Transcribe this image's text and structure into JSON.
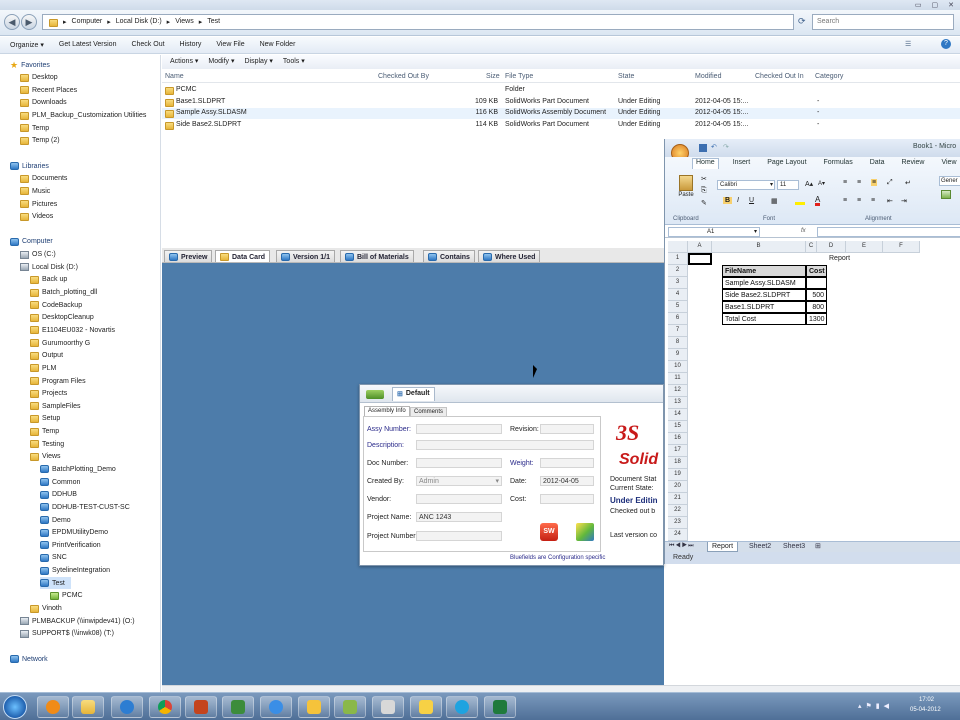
{
  "address": {
    "crumbs": [
      "Computer",
      "Local Disk (D:)",
      "Views",
      "Test"
    ],
    "search_placeholder": "Search"
  },
  "toolbar": [
    "Organize ▾",
    "Get Latest Version",
    "Check Out",
    "History",
    "View File",
    "New Folder"
  ],
  "nav": [
    {
      "label": "Favorites",
      "icon": "star-icon",
      "indent": 0
    },
    {
      "label": "Desktop",
      "icon": "folder-icon",
      "indent": 1
    },
    {
      "label": "Recent Places",
      "icon": "folder-icon",
      "indent": 1
    },
    {
      "label": "Downloads",
      "icon": "folder-icon",
      "indent": 1
    },
    {
      "label": "PLM_Backup_Customization Utilities",
      "icon": "folder-icon",
      "indent": 1
    },
    {
      "label": "Temp",
      "icon": "folder-icon",
      "indent": 1
    },
    {
      "label": "Temp (2)",
      "icon": "folder-icon",
      "indent": 1
    },
    {
      "label": "",
      "icon": "",
      "indent": 0
    },
    {
      "label": "Libraries",
      "icon": "library-icon",
      "indent": 0
    },
    {
      "label": "Documents",
      "icon": "folder-icon",
      "indent": 1
    },
    {
      "label": "Music",
      "icon": "folder-icon",
      "indent": 1
    },
    {
      "label": "Pictures",
      "icon": "folder-icon",
      "indent": 1
    },
    {
      "label": "Videos",
      "icon": "folder-icon",
      "indent": 1
    },
    {
      "label": "",
      "icon": "",
      "indent": 0
    },
    {
      "label": "Computer",
      "icon": "computer-icon",
      "indent": 0
    },
    {
      "label": "OS (C:)",
      "icon": "drive-icon",
      "indent": 1
    },
    {
      "label": "Local Disk (D:)",
      "icon": "drive-icon",
      "indent": 1
    },
    {
      "label": "Back up",
      "icon": "folder-icon",
      "indent": 2
    },
    {
      "label": "Batch_plotting_dll",
      "icon": "folder-icon",
      "indent": 2
    },
    {
      "label": "CodeBackup",
      "icon": "folder-icon",
      "indent": 2
    },
    {
      "label": "DesktopCleanup",
      "icon": "folder-icon",
      "indent": 2
    },
    {
      "label": "E1104EU032 - Novartis",
      "icon": "folder-icon",
      "indent": 2
    },
    {
      "label": "Gurumoorthy G",
      "icon": "folder-icon",
      "indent": 2
    },
    {
      "label": "Output",
      "icon": "folder-icon",
      "indent": 2
    },
    {
      "label": "PLM",
      "icon": "folder-icon",
      "indent": 2
    },
    {
      "label": "Program Files",
      "icon": "folder-icon",
      "indent": 2
    },
    {
      "label": "Projects",
      "icon": "folder-icon",
      "indent": 2
    },
    {
      "label": "SampleFiles",
      "icon": "folder-icon",
      "indent": 2
    },
    {
      "label": "Setup",
      "icon": "folder-icon",
      "indent": 2
    },
    {
      "label": "Temp",
      "icon": "folder-icon",
      "indent": 2
    },
    {
      "label": "Testing",
      "icon": "folder-icon",
      "indent": 2
    },
    {
      "label": "Views",
      "icon": "folder-icon",
      "indent": 2
    },
    {
      "label": "BatchPlotting_Demo",
      "icon": "vault-icon",
      "indent": 3
    },
    {
      "label": "Common",
      "icon": "vault-icon",
      "indent": 3
    },
    {
      "label": "DDHUB",
      "icon": "vault-icon",
      "indent": 3
    },
    {
      "label": "DDHUB-TEST-CUST-SC",
      "icon": "vault-icon",
      "indent": 3
    },
    {
      "label": "Demo",
      "icon": "vault-icon",
      "indent": 3
    },
    {
      "label": "EPDMUtilityDemo",
      "icon": "vault-icon",
      "indent": 3
    },
    {
      "label": "PrintVerification",
      "icon": "vault-icon",
      "indent": 3
    },
    {
      "label": "SNC",
      "icon": "vault-icon",
      "indent": 3
    },
    {
      "label": "SytelineIntegration",
      "icon": "vault-icon",
      "indent": 3
    },
    {
      "label": "Test",
      "icon": "vault-icon",
      "indent": 3,
      "selected": true
    },
    {
      "label": "PCMC",
      "icon": "pdm-folder-icon",
      "indent": 4
    },
    {
      "label": "Vinoth",
      "icon": "folder-icon",
      "indent": 2
    },
    {
      "label": "PLMBACKUP (\\\\inwipdev41) (O:)",
      "icon": "drive-icon",
      "indent": 1
    },
    {
      "label": "SUPPORT$ (\\\\inwk08) (T:)",
      "icon": "drive-icon",
      "indent": 1
    },
    {
      "label": "",
      "icon": "",
      "indent": 0
    },
    {
      "label": "Network",
      "icon": "network-icon",
      "indent": 0
    }
  ],
  "file_pane": {
    "menu": [
      "Actions ▾",
      "Modify ▾",
      "Display ▾",
      "Tools ▾"
    ],
    "columns": [
      "Name",
      "Checked Out By",
      "Size",
      "File Type",
      "State",
      "Modified",
      "Checked Out In",
      "Category"
    ],
    "rows": [
      {
        "name": "PCMC",
        "by": "",
        "size": "",
        "type": "Folder",
        "state": "",
        "modified": "",
        "in": "",
        "cat": ""
      },
      {
        "name": "Base1.SLDPRT",
        "by": "",
        "size": "109 KB",
        "type": "SolidWorks Part Document",
        "state": "Under Editing",
        "modified": "2012-04-05 15:...",
        "in": "-",
        "cat": ""
      },
      {
        "name": "Sample Assy.SLDASM",
        "by": "",
        "size": "116 KB",
        "type": "SolidWorks Assembly Document",
        "state": "Under Editing",
        "modified": "2012-04-05 15:...",
        "in": "-",
        "cat": ""
      },
      {
        "name": "Side Base2.SLDPRT",
        "by": "",
        "size": "114 KB",
        "type": "SolidWorks Part Document",
        "state": "Under Editing",
        "modified": "2012-04-05 15:...",
        "in": "-",
        "cat": ""
      }
    ]
  },
  "tabs": [
    "Preview",
    "Data Card",
    "Version 1/1",
    "Bill of Materials",
    "Contains",
    "Where Used"
  ],
  "card": {
    "config": "Default",
    "subtabs": [
      "Assembly Info",
      "Comments"
    ],
    "assy_number": "Assy Number:",
    "revision": "Revision:",
    "description": "Description:",
    "doc_number": "Doc Number:",
    "weight": "Weight:",
    "created_by": "Created By:",
    "created_by_value": "Admin",
    "date": "Date:",
    "date_value": "2012-04-05",
    "vendor": "Vendor:",
    "cost": "Cost:",
    "project_name": "Project Name:",
    "project_name_value": "ANC 1243",
    "project_number": "Project Number:",
    "footer": "Bluefields are Configuration specific",
    "logo_text": "Solid",
    "doc_status": "Document Stat",
    "current_state": "Current State:",
    "state_value": "Under Editin",
    "checked_out": "Checked out b",
    "last_version": "Last version co"
  },
  "excel": {
    "title": "Book1 - Micro",
    "tabs": [
      "Home",
      "Insert",
      "Page Layout",
      "Formulas",
      "Data",
      "Review",
      "View"
    ],
    "clipboard": "Clipboard",
    "paste": "Paste",
    "font_group": "Font",
    "alignment": "Alignment",
    "font_name": "Calibri",
    "font_size": "11",
    "general": "Gener",
    "name_box": "A1",
    "fx": "fx",
    "cols": [
      "A",
      "B",
      "C",
      "D",
      "E",
      "F"
    ],
    "rows": [
      "1",
      "2",
      "3",
      "4",
      "5",
      "6",
      "7",
      "8",
      "9",
      "10",
      "11",
      "12",
      "13",
      "14",
      "15",
      "16",
      "17",
      "18",
      "19",
      "20",
      "21",
      "22",
      "23",
      "24"
    ],
    "report_title": "Report",
    "table": [
      [
        "FileName",
        "Cost"
      ],
      [
        "Sample Assy.SLDASM",
        ""
      ],
      [
        "Side Base2.SLDPRT",
        "500"
      ],
      [
        "Base1.SLDPRT",
        "800"
      ],
      [
        "Total Cost",
        "1300"
      ]
    ],
    "sheets": [
      "Report",
      "Sheet2",
      "Sheet3"
    ],
    "status": "Ready"
  },
  "taskbar": {
    "time": "17:02",
    "date": "05-04-2012"
  },
  "colors": {
    "workspace": "#4d7caa",
    "accent": "#2f78c4"
  }
}
